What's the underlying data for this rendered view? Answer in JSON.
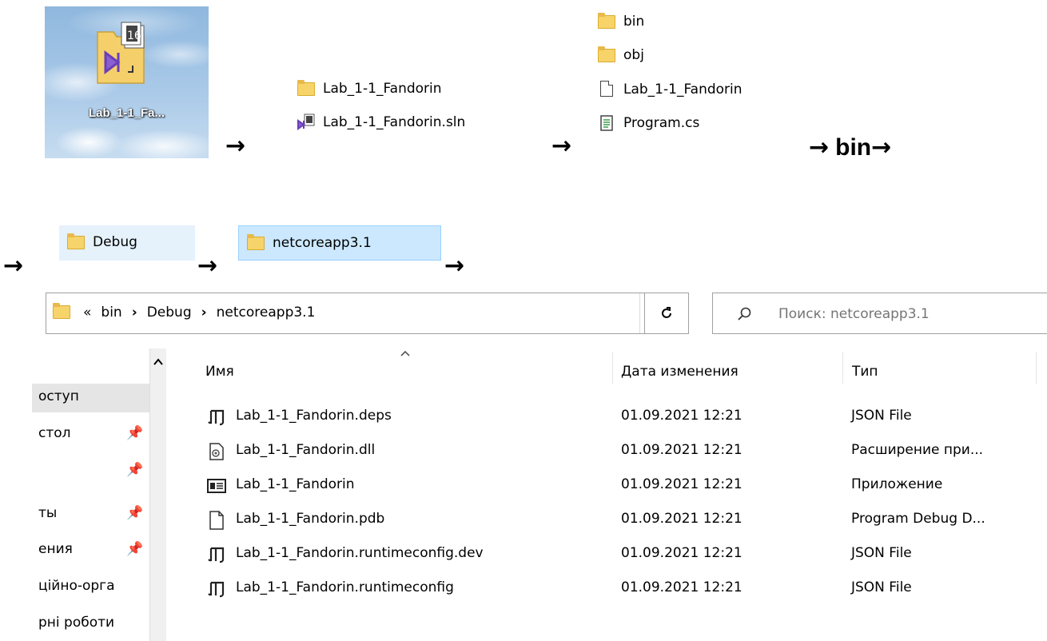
{
  "desktop_icon": {
    "label": "Lab_1-1_Fa...",
    "badge": "16"
  },
  "arrows": "→",
  "bin_step_text": "bin",
  "solution_listing": [
    {
      "label": "Lab_1-1_Fandorin",
      "icon": "folder-icon"
    },
    {
      "label": "Lab_1-1_Fandorin.sln",
      "icon": "vs-solution-icon"
    }
  ],
  "project_listing": [
    {
      "label": "bin",
      "icon": "folder-icon"
    },
    {
      "label": "obj",
      "icon": "folder-icon"
    },
    {
      "label": "Lab_1-1_Fandorin",
      "icon": "file-icon"
    },
    {
      "label": "Program.cs",
      "icon": "text-file-icon"
    }
  ],
  "path_folders": [
    {
      "label": "Debug"
    },
    {
      "label": "netcoreapp3.1"
    }
  ],
  "address_bar": {
    "overflow": "«",
    "crumbs": [
      "bin",
      "Debug",
      "netcoreapp3.1"
    ],
    "separator": "›"
  },
  "search": {
    "placeholder": "Поиск: netcoreapp3.1"
  },
  "nav_pane": {
    "items": [
      {
        "label": "оступ",
        "pinned": false,
        "selected": true
      },
      {
        "label": "стол",
        "pinned": true
      },
      {
        "label": "",
        "pinned": true
      },
      {
        "label": "ты",
        "pinned": true
      },
      {
        "label": "ения",
        "pinned": true
      },
      {
        "label": "ційно-орга",
        "pinned": false
      },
      {
        "label": "рні роботи",
        "pinned": false
      }
    ]
  },
  "columns": {
    "name": "Имя",
    "date": "Дата изменения",
    "type": "Тип"
  },
  "files": [
    {
      "name": "Lab_1-1_Fandorin.deps",
      "date": "01.09.2021 12:21",
      "type": "JSON File",
      "icon": "json-icon"
    },
    {
      "name": "Lab_1-1_Fandorin.dll",
      "date": "01.09.2021 12:21",
      "type": "Расширение при...",
      "icon": "dll-icon"
    },
    {
      "name": "Lab_1-1_Fandorin",
      "date": "01.09.2021 12:21",
      "type": "Приложение",
      "icon": "exe-icon"
    },
    {
      "name": "Lab_1-1_Fandorin.pdb",
      "date": "01.09.2021 12:21",
      "type": "Program Debug D...",
      "icon": "file-icon"
    },
    {
      "name": "Lab_1-1_Fandorin.runtimeconfig.dev",
      "date": "01.09.2021 12:21",
      "type": "JSON File",
      "icon": "json-icon"
    },
    {
      "name": "Lab_1-1_Fandorin.runtimeconfig",
      "date": "01.09.2021 12:21",
      "type": "JSON File",
      "icon": "json-icon"
    }
  ]
}
